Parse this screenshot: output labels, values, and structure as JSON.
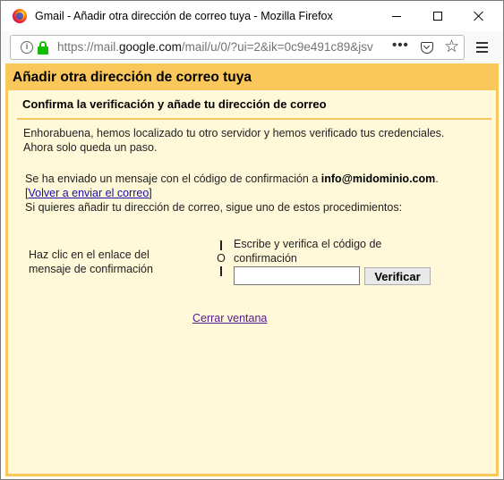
{
  "window": {
    "title": "Gmail - Añadir otra dirección de correo tuya - Mozilla Firefox",
    "icon": "firefox-icon"
  },
  "urlbar": {
    "prefix": "https://mail.",
    "host": "google.com",
    "suffix": "/mail/u/0/?ui=2&ik=0c9e491c89&jsv",
    "more": "•••"
  },
  "page": {
    "header": "Añadir otra dirección de correo tuya",
    "subheader": "Confirma la verificación y añade tu dirección de correo",
    "intro": "Enhorabuena, hemos localizado tu otro servidor y hemos verificado tus credenciales. Ahora solo queda un paso.",
    "sent_prefix": "Se ha enviado un mensaje con el código de confirmación a ",
    "sent_email": "info@midominio.com",
    "sent_suffix": ".",
    "resend_open": "[",
    "resend_link": "Volver a enviar el correo",
    "resend_close": "]",
    "howto": "Si quieres añadir tu dirección de correo, sigue uno de estos procedimientos:",
    "option_left": "Haz clic en el enlace del mensaje de confirmación",
    "separator": "O",
    "option_right": "Escribe y verifica el código de confirmación",
    "code_value": "",
    "verify_label": "Verificar",
    "close_link": "Cerrar ventana"
  },
  "colors": {
    "header_bg": "#fac85a",
    "panel_bg": "#fff8d9",
    "link": "#1a0dab",
    "visited_link": "#551a8b",
    "lock": "#12bc00"
  }
}
